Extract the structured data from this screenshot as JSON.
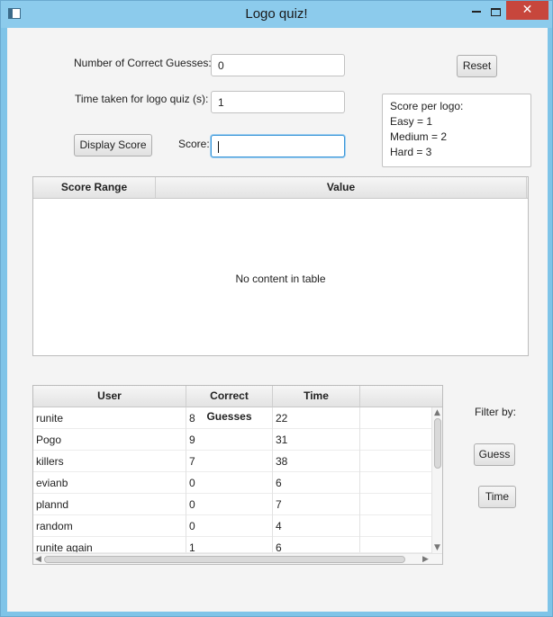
{
  "window": {
    "title": "Logo quiz!",
    "close_glyph": "✕"
  },
  "form": {
    "correct_label": "Number of Correct Guesses:",
    "correct_value": "0",
    "time_label": "Time taken for logo quiz (s):",
    "time_value": "1",
    "score_label": "Score:",
    "score_value": "",
    "display_button": "Display Score",
    "reset_button": "Reset"
  },
  "info": {
    "lines": [
      "Score per logo:",
      "Easy = 1",
      "Medium = 2",
      "Hard = 3"
    ]
  },
  "score_table": {
    "columns": [
      "Score Range",
      "Value"
    ],
    "placeholder": "No content in table"
  },
  "user_table": {
    "columns": [
      "User",
      "Correct Guesses",
      "Time"
    ],
    "rows": [
      [
        "runite",
        "8",
        "22"
      ],
      [
        "Pogo",
        "9",
        "31"
      ],
      [
        "killers",
        "7",
        "38"
      ],
      [
        "evianb",
        "0",
        "6"
      ],
      [
        "plannd",
        "0",
        "7"
      ],
      [
        "random",
        "0",
        "4"
      ],
      [
        "runite again",
        "1",
        "6"
      ]
    ]
  },
  "filter": {
    "label": "Filter by:",
    "guess_button": "Guess",
    "time_button": "Time"
  }
}
